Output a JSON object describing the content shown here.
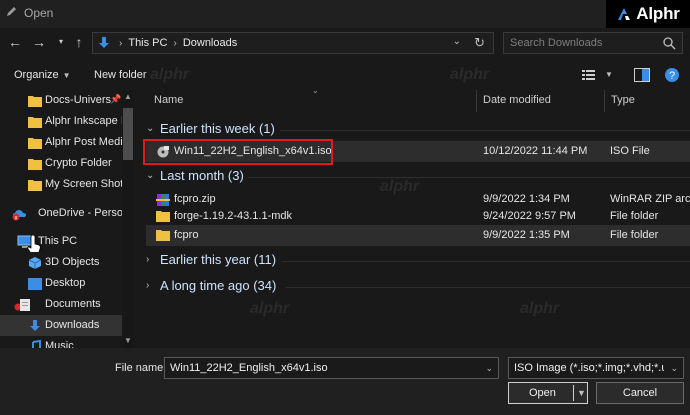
{
  "window": {
    "title": "Open",
    "title_icon": "pencil-icon",
    "brand": "Alphr"
  },
  "address_bar": {
    "crumbs": [
      "This PC",
      "Downloads"
    ],
    "search_placeholder": "Search Downloads"
  },
  "toolbar": {
    "organize_label": "Organize",
    "new_folder_label": "New folder"
  },
  "sidebar": {
    "items": [
      {
        "label": "Docs-Univers",
        "icon": "folder-icon"
      },
      {
        "label": "Alphr Inkscape I",
        "icon": "folder-icon"
      },
      {
        "label": "Alphr Post Medi",
        "icon": "folder-icon"
      },
      {
        "label": "Crypto Folder",
        "icon": "folder-icon"
      },
      {
        "label": "My Screen Shots",
        "icon": "folder-icon"
      },
      {
        "label": "OneDrive - Person",
        "icon": "onedrive-error-icon"
      },
      {
        "label": "This PC",
        "icon": "this-pc-icon"
      },
      {
        "label": "3D Objects",
        "icon": "3d-objects-icon"
      },
      {
        "label": "Desktop",
        "icon": "desktop-icon"
      },
      {
        "label": "Documents",
        "icon": "documents-icon"
      },
      {
        "label": "Downloads",
        "icon": "downloads-icon"
      },
      {
        "label": "Music",
        "icon": "music-icon"
      }
    ]
  },
  "columns": {
    "name": "Name",
    "date_modified": "Date modified",
    "type": "Type"
  },
  "groups": [
    {
      "label": "Earlier this week (1)",
      "expanded": true,
      "rows": [
        {
          "name": "Win11_22H2_English_x64v1.iso",
          "date": "10/12/2022 11:44 PM",
          "type": "ISO File",
          "icon": "iso-file-icon"
        }
      ]
    },
    {
      "label": "Last month (3)",
      "expanded": true,
      "rows": [
        {
          "name": "fcpro.zip",
          "date": "9/9/2022 1:34 PM",
          "type": "WinRAR ZIP archive",
          "icon": "zip-file-icon"
        },
        {
          "name": "forge-1.19.2-43.1.1-mdk",
          "date": "9/24/2022 9:57 PM",
          "type": "File folder",
          "icon": "folder-icon"
        },
        {
          "name": "fcpro",
          "date": "9/9/2022 1:35 PM",
          "type": "File folder",
          "icon": "folder-icon"
        }
      ]
    },
    {
      "label": "Earlier this year (11)",
      "expanded": false,
      "rows": []
    },
    {
      "label": "A long time ago (34)",
      "expanded": false,
      "rows": []
    }
  ],
  "bottom": {
    "file_name_label": "File name:",
    "file_name_value": "Win11_22H2_English_x64v1.iso",
    "file_type_value": "ISO Image (*.iso;*.img;*.vhd;*.u",
    "open_label": "Open",
    "cancel_label": "Cancel"
  },
  "colors": {
    "highlight": "#e01b1b",
    "folder": "#f0c040",
    "accent_blue": "#3a8ee6"
  },
  "watermark": "alphr"
}
